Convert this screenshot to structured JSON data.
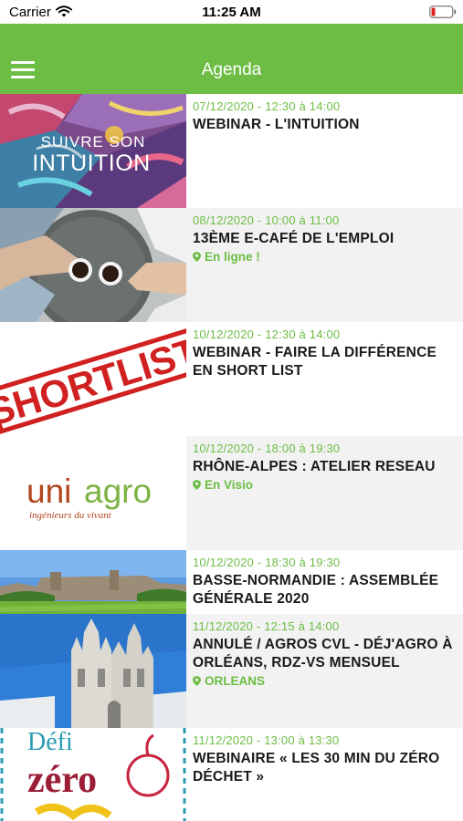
{
  "status_bar": {
    "carrier": "Carrier",
    "time": "11:25 AM"
  },
  "header": {
    "title": "Agenda",
    "menu_icon": "hamburger-icon"
  },
  "events": [
    {
      "date": "07/12/2020 - 12:30 à 14:00",
      "title": "WEBINAR - L'INTUITION",
      "location": "",
      "image_text": [
        "SUIVRE SON",
        "INTUITION"
      ]
    },
    {
      "date": "08/12/2020 - 10:00 à 11:00",
      "title": "13ÈME E-CAFÉ DE L'EMPLOI",
      "location": "En ligne !"
    },
    {
      "date": "10/12/2020 - 12:30 à 14:00",
      "title": "WEBINAR - FAIRE LA DIFFÉRENCE EN SHORT LIST",
      "location": "",
      "image_text": [
        "SHORTLIST"
      ]
    },
    {
      "date": "10/12/2020 - 18:00 à 19:30",
      "title": "RHÔNE-ALPES : ATELIER RESEAU",
      "location": "En Visio",
      "image_text": [
        "uni",
        "agro",
        "ingénieurs du vivant"
      ]
    },
    {
      "date": "10/12/2020 - 18:30 à 19:30",
      "title": "BASSE-NORMANDIE : ASSEMBLÉE GÉNÉRALE 2020",
      "location": ""
    },
    {
      "date": "11/12/2020 - 12:15 à 14:00",
      "title": "ANNULÉ / AGROS CVL - DÉJ'AGRO À ORLÉANS, RDZ-VS MENSUEL",
      "location": "ORLEANS"
    },
    {
      "date": "11/12/2020 - 13:00 à 13:30",
      "title": "WEBINAIRE « LES 30 MIN DU ZÉRO DÉCHET »",
      "location": "",
      "image_text": [
        "Défi",
        "zéro"
      ]
    }
  ],
  "colors": {
    "accent": "#6dbd45",
    "row_alt": "#f2f2f2",
    "title_text": "#1a1a1a"
  }
}
